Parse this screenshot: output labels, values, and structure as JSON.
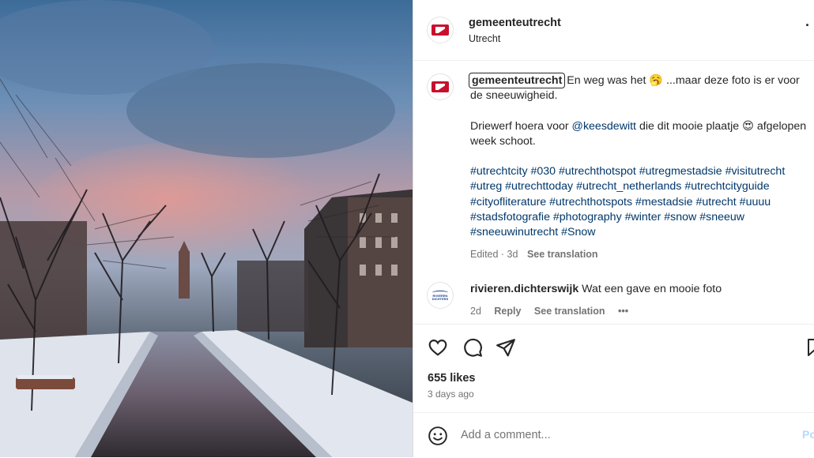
{
  "post": {
    "username": "gemeenteutrecht",
    "location": "Utrecht",
    "more_label": "...",
    "avatar_label": "Gemeente Utrecht"
  },
  "caption": {
    "username": "gemeenteutrecht",
    "line1_a": "En weg was het",
    "line1_emoji": "🥱",
    "line1_b": "...maar deze foto is er voor de sneeuwigheid.",
    "line2_a": "Driewerf hoera voor",
    "mention": "@keesdewitt",
    "line2_b": "die dit mooie plaatje",
    "line2_emoji": "😍",
    "line2_c": "afgelopen week schoot.",
    "hashtags": "#utrechtcity #030 #utrechthotspot #utregmestadsie #visitutrecht #utreg #utrechttoday #utrecht_netherlands #utrechtcityguide #cityofliterature #utrechthotspots #mestadsie #utrecht #uuuu #stadsfotografie #photography #winter #snow #sneeuw #sneeuwinutrecht #Snow",
    "edited": "Edited · 3d",
    "see_translation": "See translation"
  },
  "comment": {
    "username": "rivieren.dichterswijk",
    "text": "Wat een gave en mooie foto",
    "time": "2d",
    "reply": "Reply",
    "see_translation": "See translation",
    "more": "•••",
    "avatar_line1": "RIVIEREN",
    "avatar_line2": "DICHTERS"
  },
  "stats": {
    "likes": "655 likes",
    "time": "3 days ago"
  },
  "add_comment": {
    "placeholder": "Add a comment...",
    "post_label": "Po"
  },
  "icons": {
    "like": "heart-icon",
    "comment": "speech-bubble-icon",
    "share": "paper-plane-icon",
    "save": "bookmark-icon",
    "emoji": "smiley-icon"
  }
}
